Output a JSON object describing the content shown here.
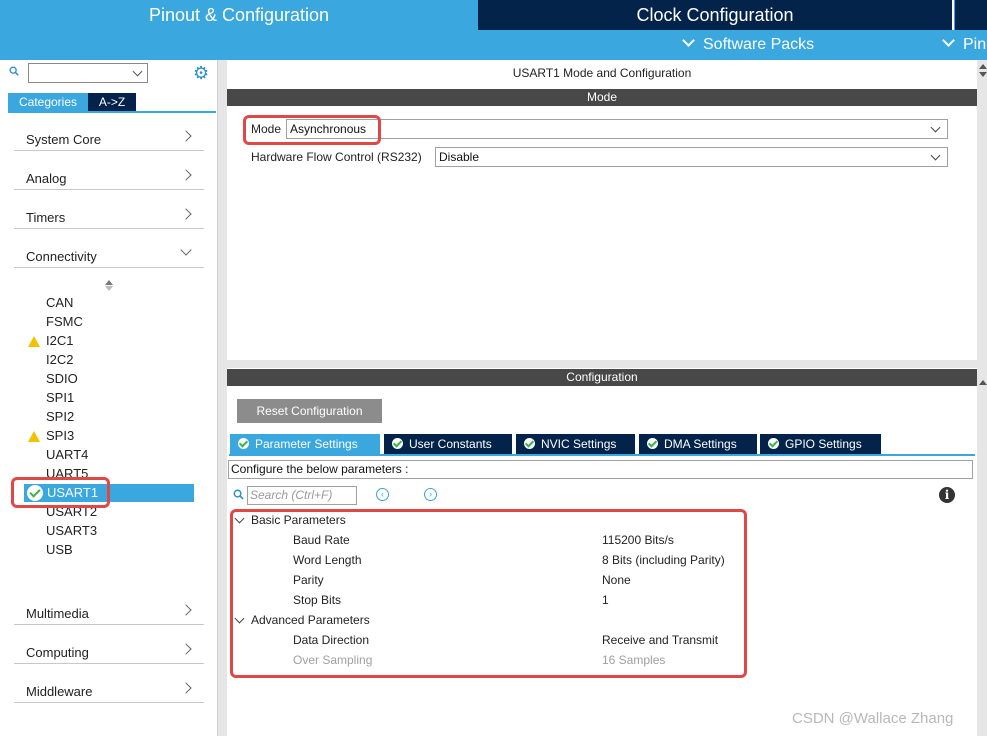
{
  "top_tabs": {
    "pinout": "Pinout & Configuration",
    "clock": "Clock Configuration"
  },
  "subbar": {
    "software_packs": "Software Packs",
    "pinout_truncated": "Pin"
  },
  "left": {
    "categories_label": "Categories",
    "az_label": "A->Z",
    "categories": [
      {
        "label": "System Core"
      },
      {
        "label": "Analog"
      },
      {
        "label": "Timers"
      },
      {
        "label": "Connectivity"
      },
      {
        "label": "Multimedia"
      },
      {
        "label": "Computing"
      },
      {
        "label": "Middleware"
      }
    ],
    "connectivity_items": [
      {
        "label": "CAN",
        "status": "none"
      },
      {
        "label": "FSMC",
        "status": "none"
      },
      {
        "label": "I2C1",
        "status": "warning"
      },
      {
        "label": "I2C2",
        "status": "none"
      },
      {
        "label": "SDIO",
        "status": "none"
      },
      {
        "label": "SPI1",
        "status": "none"
      },
      {
        "label": "SPI2",
        "status": "none"
      },
      {
        "label": "SPI3",
        "status": "warning"
      },
      {
        "label": "UART4",
        "status": "none"
      },
      {
        "label": "UART5",
        "status": "none"
      },
      {
        "label": "USART1",
        "status": "selected"
      },
      {
        "label": "USART2",
        "status": "none"
      },
      {
        "label": "USART3",
        "status": "none"
      },
      {
        "label": "USB",
        "status": "none"
      }
    ]
  },
  "mode_panel": {
    "title": "USART1 Mode and Configuration",
    "section": "Mode",
    "mode_label": "Mode",
    "mode_value": "Asynchronous",
    "flow_label": "Hardware Flow Control (RS232)",
    "flow_value": "Disable"
  },
  "config_panel": {
    "section": "Configuration",
    "reset_button": "Reset Configuration",
    "tabs": [
      {
        "label": "Parameter Settings",
        "active": true
      },
      {
        "label": "User Constants",
        "active": false
      },
      {
        "label": "NVIC Settings",
        "active": false
      },
      {
        "label": "DMA Settings",
        "active": false
      },
      {
        "label": "GPIO Settings",
        "active": false
      }
    ],
    "configure_text": "Configure the below parameters :",
    "search_placeholder": "Search (Ctrl+F)",
    "groups": [
      {
        "name": "Basic Parameters",
        "params": [
          {
            "name": "Baud Rate",
            "value": "115200 Bits/s",
            "disabled": false
          },
          {
            "name": "Word Length",
            "value": "8 Bits (including Parity)",
            "disabled": false
          },
          {
            "name": "Parity",
            "value": "None",
            "disabled": false
          },
          {
            "name": "Stop Bits",
            "value": "1",
            "disabled": false
          }
        ]
      },
      {
        "name": "Advanced Parameters",
        "params": [
          {
            "name": "Data Direction",
            "value": "Receive and Transmit",
            "disabled": false
          },
          {
            "name": "Over Sampling",
            "value": "16 Samples",
            "disabled": true
          }
        ]
      }
    ]
  },
  "watermark": "CSDN @Wallace Zhang",
  "colors": {
    "accent": "#3aa7de",
    "dark_navy": "#03234b",
    "section_bar": "#484848",
    "highlight_red": "#e04848",
    "warning": "#f2c200",
    "check_green": "#3bb54a"
  }
}
